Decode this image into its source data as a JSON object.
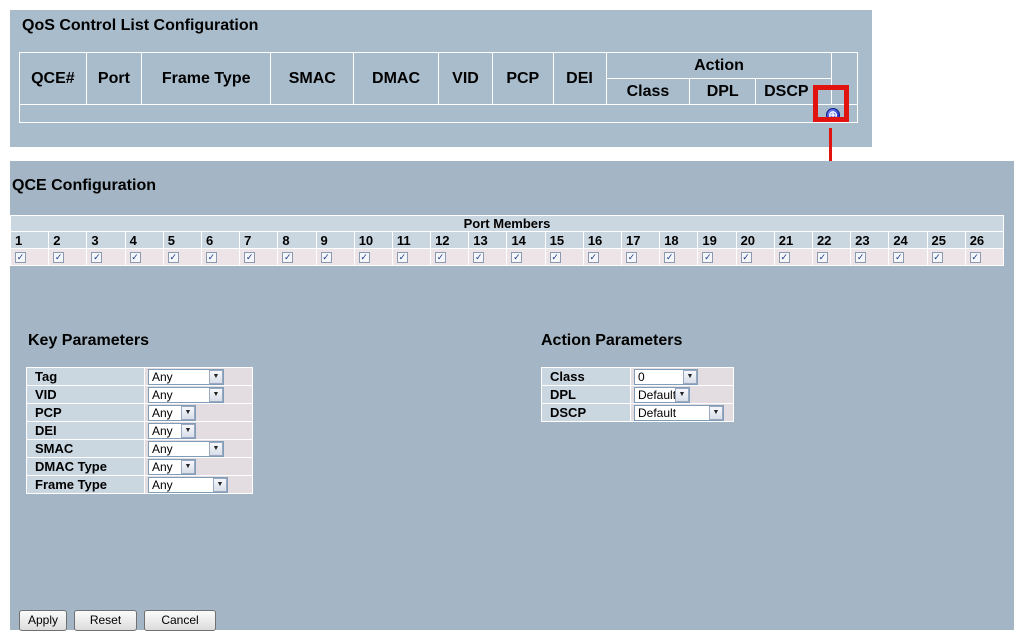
{
  "list_panel": {
    "title": "QoS Control List Configuration",
    "columns": [
      "QCE#",
      "Port",
      "Frame Type",
      "SMAC",
      "DMAC",
      "VID",
      "PCP",
      "DEI"
    ],
    "action_header": "Action",
    "action_columns": [
      "Class",
      "DPL",
      "DSCP"
    ],
    "add_icon_glyph": "⊕",
    "highlight_color": "#e0130f"
  },
  "qce": {
    "title": "QCE Configuration",
    "port_members_label": "Port Members",
    "ports": [
      "1",
      "2",
      "3",
      "4",
      "5",
      "6",
      "7",
      "8",
      "9",
      "10",
      "11",
      "12",
      "13",
      "14",
      "15",
      "16",
      "17",
      "18",
      "19",
      "20",
      "21",
      "22",
      "23",
      "24",
      "25",
      "26"
    ],
    "checkbox_glyph": "✓",
    "key_parameters": {
      "title": "Key Parameters",
      "rows": [
        {
          "label": "Tag",
          "value": "Any"
        },
        {
          "label": "VID",
          "value": "Any"
        },
        {
          "label": "PCP",
          "value": "Any"
        },
        {
          "label": "DEI",
          "value": "Any"
        },
        {
          "label": "SMAC",
          "value": "Any"
        },
        {
          "label": "DMAC Type",
          "value": "Any"
        },
        {
          "label": "Frame Type",
          "value": "Any"
        }
      ]
    },
    "action_parameters": {
      "title": "Action Parameters",
      "rows": [
        {
          "label": "Class",
          "value": "0"
        },
        {
          "label": "DPL",
          "value": "Default"
        },
        {
          "label": "DSCP",
          "value": "Default"
        }
      ]
    },
    "buttons": {
      "apply": "Apply",
      "reset": "Reset",
      "cancel": "Cancel"
    },
    "dropdown_glyph": "▼"
  }
}
